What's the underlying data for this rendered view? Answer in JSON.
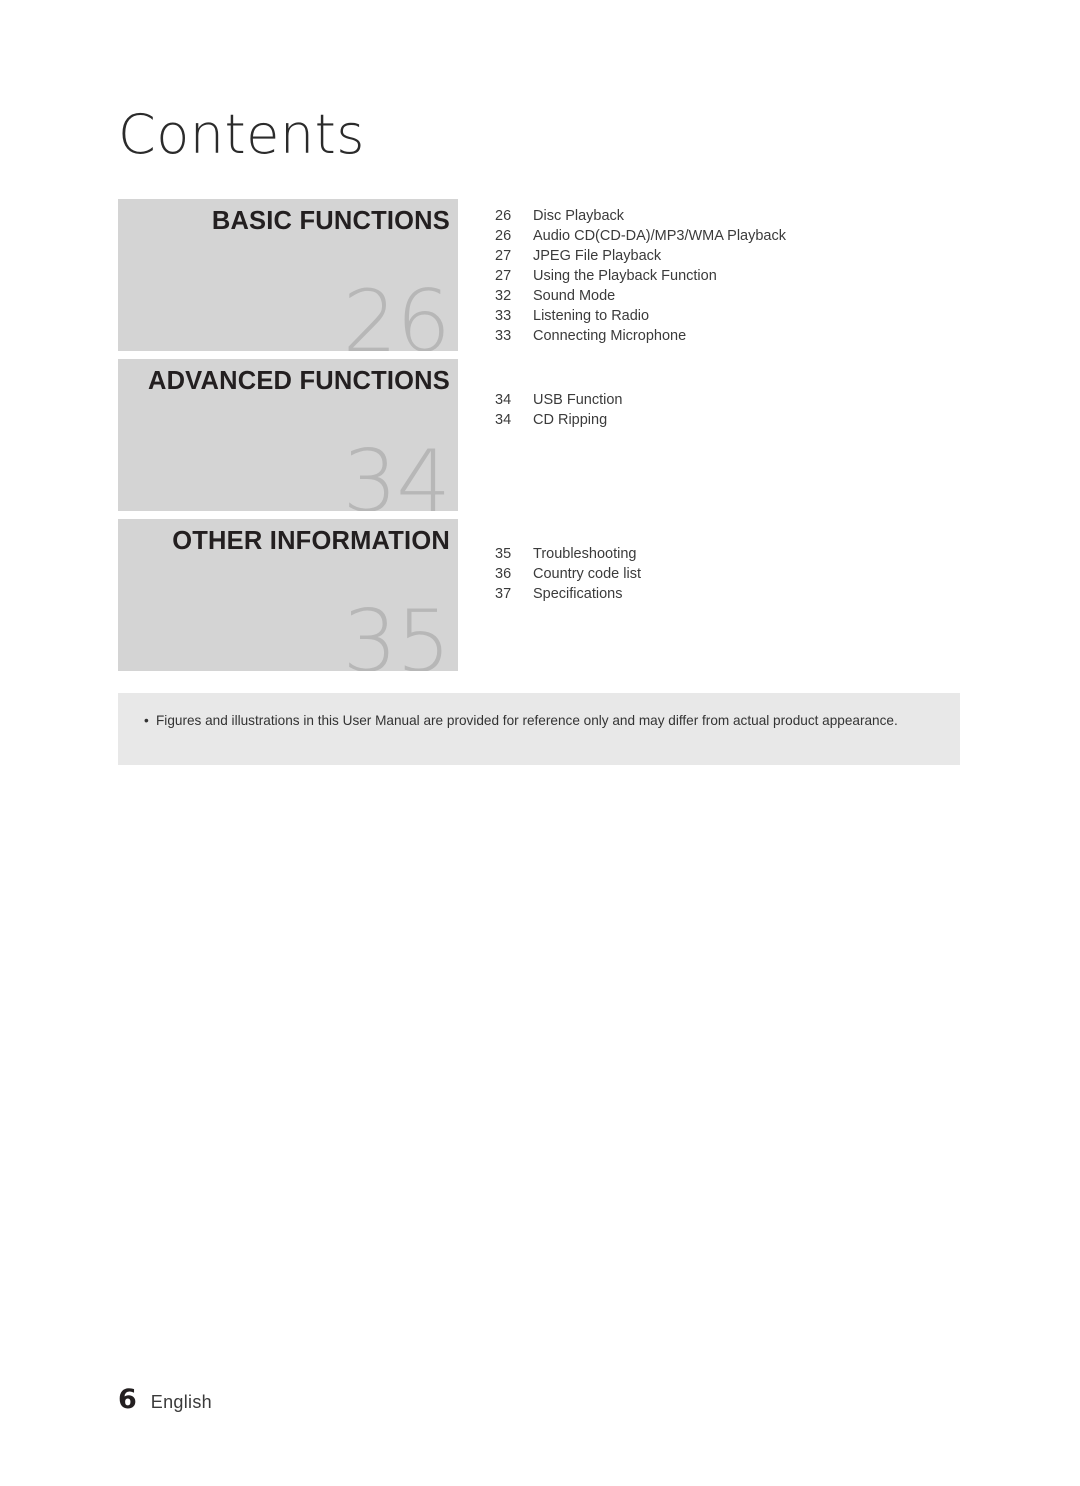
{
  "page": {
    "title": "Contents",
    "footer_page_number": "6",
    "footer_language": "English"
  },
  "sections": [
    {
      "heading": "BASIC FUNCTIONS",
      "number": "26"
    },
    {
      "heading": "ADVANCED FUNCTIONS",
      "number": "34"
    },
    {
      "heading": "OTHER INFORMATION",
      "number": "35"
    }
  ],
  "toc_groups": [
    {
      "entries": [
        {
          "page": "26",
          "label": "Disc Playback"
        },
        {
          "page": "26",
          "label": "Audio CD(CD-DA)/MP3/WMA Playback"
        },
        {
          "page": "27",
          "label": "JPEG File Playback"
        },
        {
          "page": "27",
          "label": "Using the Playback Function"
        },
        {
          "page": "32",
          "label": "Sound Mode"
        },
        {
          "page": "33",
          "label": "Listening to Radio"
        },
        {
          "page": "33",
          "label": "Connecting Microphone"
        }
      ]
    },
    {
      "entries": [
        {
          "page": "34",
          "label": "USB Function"
        },
        {
          "page": "34",
          "label": "CD Ripping"
        }
      ]
    },
    {
      "entries": [
        {
          "page": "35",
          "label": "Troubleshooting"
        },
        {
          "page": "36",
          "label": "Country code list"
        },
        {
          "page": "37",
          "label": "Specifications"
        }
      ]
    }
  ],
  "note": {
    "bullet": "•",
    "text": "Figures and illustrations in this User Manual are provided for reference only and may differ from actual product appearance."
  }
}
